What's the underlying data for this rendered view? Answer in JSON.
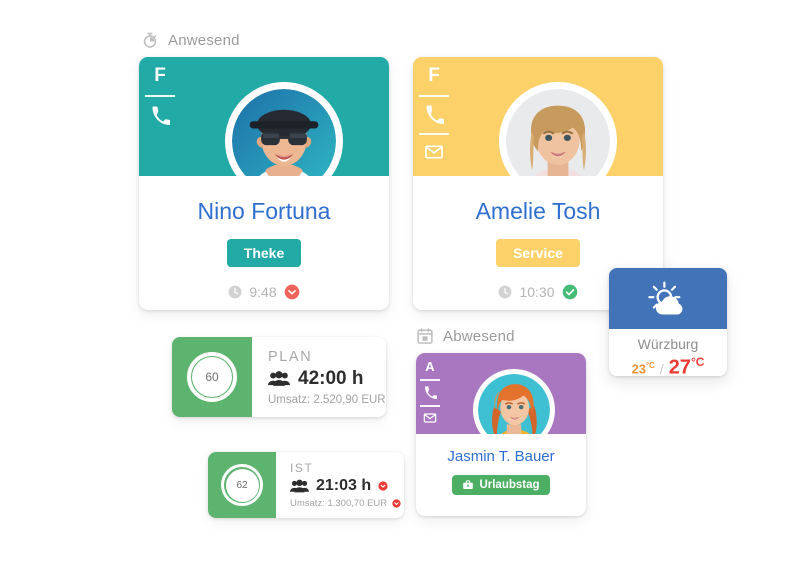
{
  "sections": {
    "present": {
      "label": "Anwesend",
      "icon": "stopwatch-icon"
    },
    "absent": {
      "label": "Abwesend",
      "icon": "calendar-icon"
    }
  },
  "employees": [
    {
      "id": "nino-fortuna",
      "name": "Nino Fortuna",
      "rail_letter": "F",
      "rail_icons": [
        "phone-icon"
      ],
      "header_color": "#22aaa6",
      "badge": {
        "text": "Theke",
        "color": "#22aaa6"
      },
      "time": "9:48",
      "status_icon": "chevron-down-circle-icon",
      "status_color": "#f0635c",
      "avatar": "man-with-hat-sunglasses"
    },
    {
      "id": "amelie-tosh",
      "name": "Amelie Tosh",
      "rail_letter": "F",
      "rail_icons": [
        "phone-icon",
        "mail-icon"
      ],
      "header_color": "#fcd169",
      "badge": {
        "text": "Service",
        "color": "#fcd169"
      },
      "time": "10:30",
      "status_icon": "check-circle-icon",
      "status_color": "#46bd77",
      "avatar": "blonde-woman"
    },
    {
      "id": "jasmin-t-bauer",
      "name": "Jasmin T. Bauer",
      "rail_letter": "A",
      "rail_icons": [
        "phone-icon",
        "mail-icon"
      ],
      "header_color": "#a877c0",
      "badge": {
        "text": "Urlaubstag",
        "color": "#4caf63",
        "icon": "briefcase-icon"
      },
      "avatar": "red-haired-woman"
    }
  ],
  "stats": [
    {
      "id": "plan",
      "label": "PLAN",
      "ring_value": "60",
      "hours": "42:00 h",
      "revenue": "Umsatz: 2.520,90 EUR",
      "accent": "#5cb46f",
      "hours_warning": false,
      "revenue_warning": false
    },
    {
      "id": "ist",
      "label": "IST",
      "ring_value": "62",
      "hours": "21:03 h",
      "revenue": "Umsatz: 1.300,70 EUR",
      "accent": "#5cb46f",
      "hours_warning": true,
      "revenue_warning": true,
      "warning_color": "#ef3b33"
    }
  ],
  "weather": {
    "city": "Würzburg",
    "icon": "sun-behind-cloud-icon",
    "low": "23",
    "high": "27",
    "unit": "°C",
    "separator": "/",
    "header_color": "#4272b8"
  }
}
